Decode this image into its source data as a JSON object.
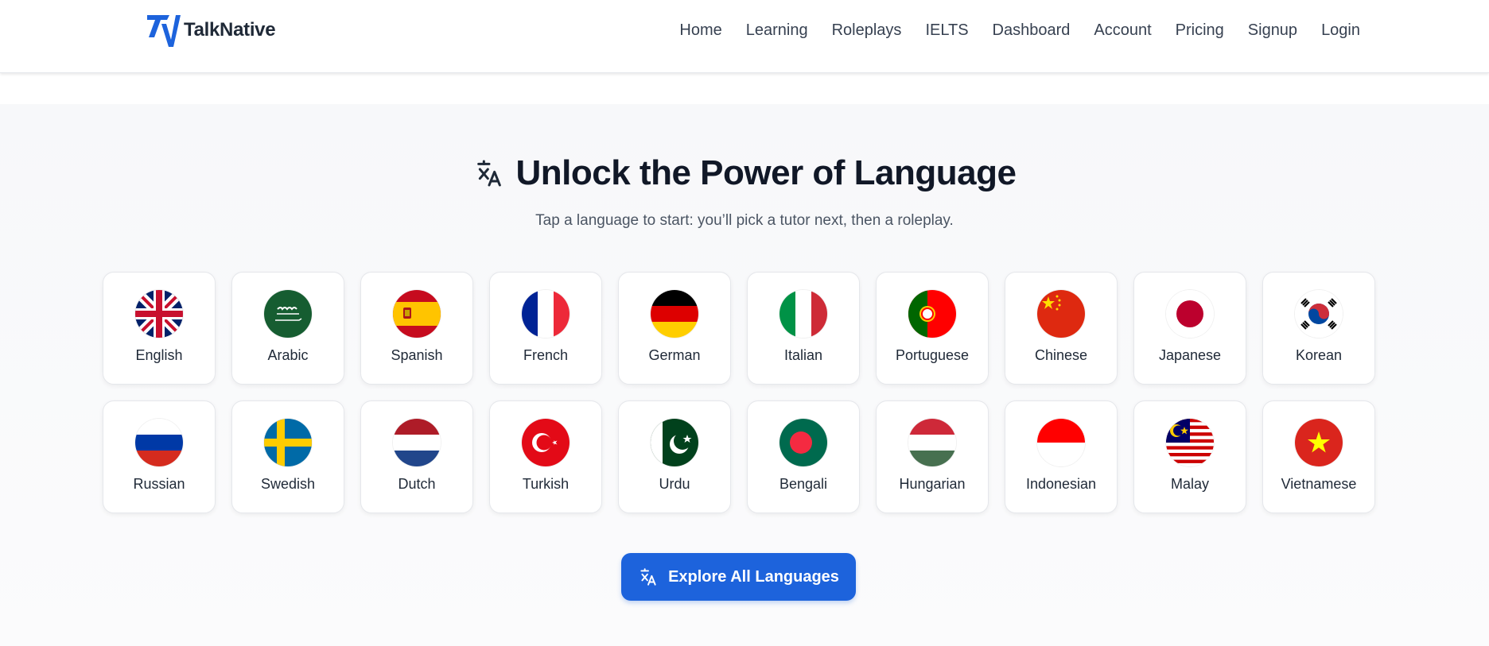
{
  "brand": {
    "name": "TalkNative",
    "logo_icon": "tn-logo-icon",
    "accent": "#1d63dc"
  },
  "nav": [
    {
      "label": "Home"
    },
    {
      "label": "Learning"
    },
    {
      "label": "Roleplays"
    },
    {
      "label": "IELTS"
    },
    {
      "label": "Dashboard"
    },
    {
      "label": "Account"
    },
    {
      "label": "Pricing"
    },
    {
      "label": "Signup"
    },
    {
      "label": "Login"
    }
  ],
  "hero": {
    "icon": "translate-icon",
    "title": "Unlock the Power of Language",
    "subtitle": "Tap a language to start: you’ll pick a tutor next, then a roleplay."
  },
  "languages": [
    {
      "name": "English"
    },
    {
      "name": "Arabic"
    },
    {
      "name": "Spanish"
    },
    {
      "name": "French"
    },
    {
      "name": "German"
    },
    {
      "name": "Italian"
    },
    {
      "name": "Portuguese"
    },
    {
      "name": "Chinese"
    },
    {
      "name": "Japanese"
    },
    {
      "name": "Korean"
    },
    {
      "name": "Russian"
    },
    {
      "name": "Swedish"
    },
    {
      "name": "Dutch"
    },
    {
      "name": "Turkish"
    },
    {
      "name": "Urdu"
    },
    {
      "name": "Bengali"
    },
    {
      "name": "Hungarian"
    },
    {
      "name": "Indonesian"
    },
    {
      "name": "Malay"
    },
    {
      "name": "Vietnamese"
    }
  ],
  "cta": {
    "label": "Explore All Languages",
    "icon": "translate-icon"
  }
}
